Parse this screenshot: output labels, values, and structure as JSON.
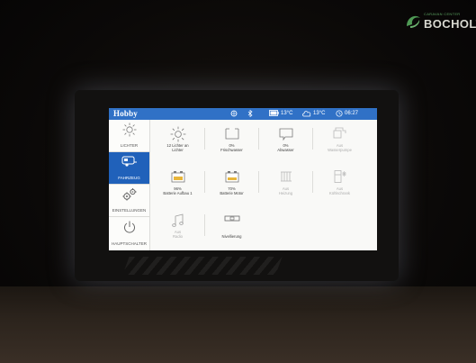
{
  "watermark": {
    "small_text": "CARAVAN CENTER",
    "big_text": "BOCHOLT",
    "accent": "#5aa060"
  },
  "statusbar": {
    "brand": "Hobby",
    "battery_temp": "13°C",
    "outside_temp": "13°C",
    "time": "06:27",
    "icons": [
      "fan-icon",
      "bluetooth-icon",
      "battery-icon",
      "cloud-icon",
      "clock-icon"
    ],
    "color": "#2f6fc2"
  },
  "sidebar": {
    "items": [
      {
        "label": "LICHTER",
        "icon": "sun-icon"
      },
      {
        "label": "FAHRZEUG",
        "icon": "caravan-icon",
        "active": true
      },
      {
        "label": "EINSTELLUNGEN",
        "icon": "gears-icon"
      },
      {
        "label": "HAUPTSCHALTER",
        "icon": "power-icon"
      }
    ],
    "active_color": "#1f5fb6"
  },
  "tiles": [
    {
      "line1": "12 Lichter an",
      "line2": "Lichter",
      "icon": "sun-icon"
    },
    {
      "line1": "0%",
      "line2": "Frischwasser",
      "icon": "freshwater-tank-icon"
    },
    {
      "line1": "0%",
      "line2": "Abwasser",
      "icon": "wastewater-tank-icon"
    },
    {
      "line1": "Aus",
      "line2": "Wasserpumpe",
      "icon": "water-pump-icon"
    },
    {
      "line1": "96%",
      "line2": "Batterie Aufbau 1",
      "icon": "battery-icon"
    },
    {
      "line1": "70%",
      "line2": "Batterie Motor",
      "icon": "battery-icon"
    },
    {
      "line1": "Aus",
      "line2": "Heizung",
      "icon": "heater-icon"
    },
    {
      "line1": "Aus",
      "line2": "Kühlschrank",
      "icon": "fridge-icon"
    },
    {
      "line1": "Aus",
      "line2": "Radio",
      "icon": "music-note-icon"
    },
    {
      "line1": "",
      "line2": "Nivellierung",
      "icon": "level-icon"
    }
  ]
}
